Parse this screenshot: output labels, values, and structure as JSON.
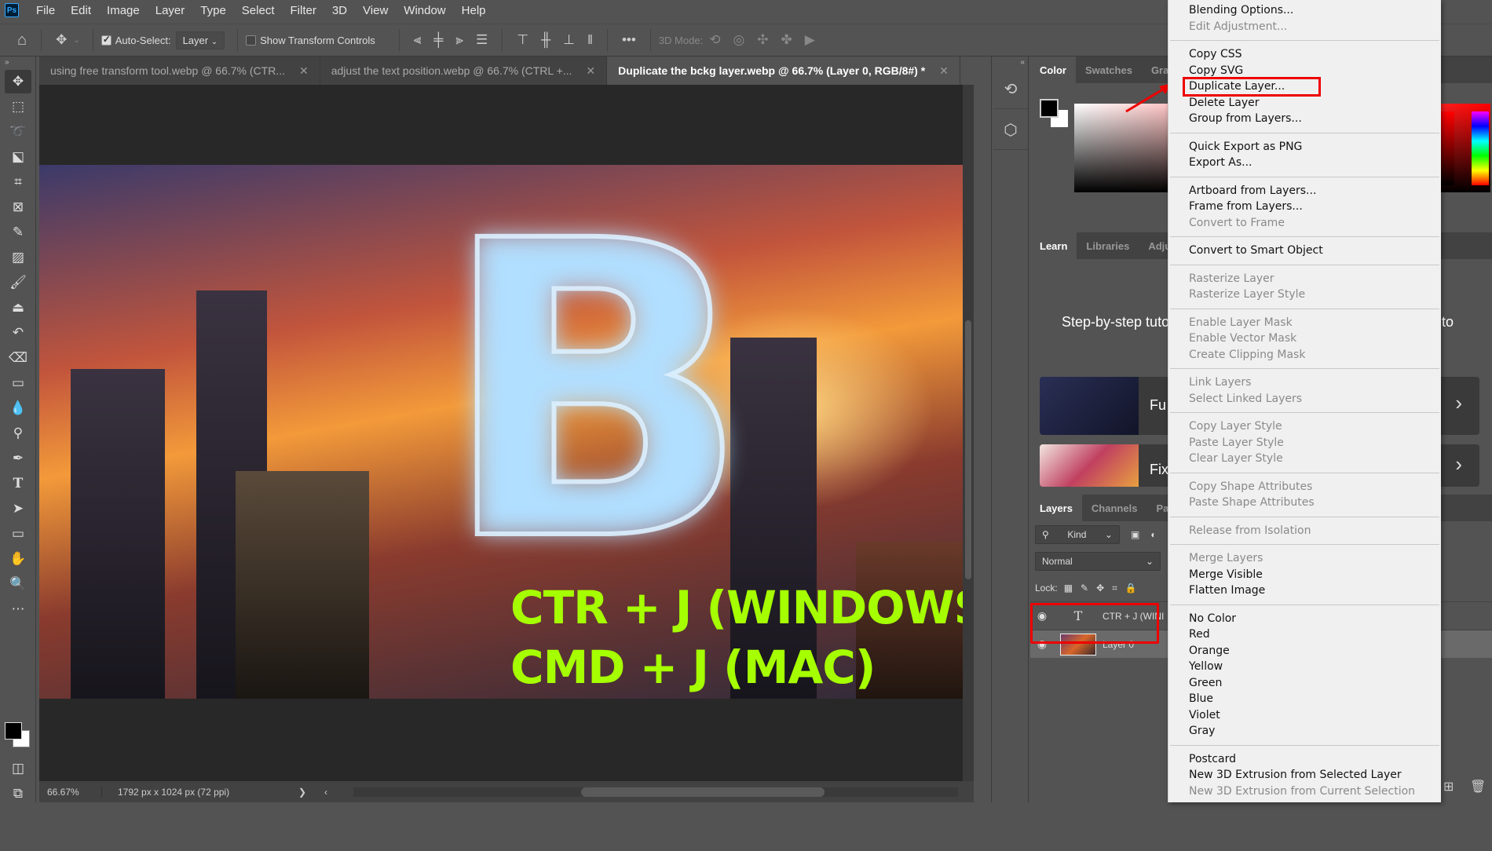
{
  "app": {
    "logo": "Ps"
  },
  "menubar": [
    "File",
    "Edit",
    "Image",
    "Layer",
    "Type",
    "Select",
    "Filter",
    "3D",
    "View",
    "Window",
    "Help"
  ],
  "options_bar": {
    "auto_select_label": "Auto-Select:",
    "auto_select_checked": true,
    "auto_select_target": "Layer",
    "show_transform_label": "Show Transform Controls",
    "show_transform_checked": false,
    "more": "•••",
    "mode_3d_label": "3D Mode:"
  },
  "document_tabs": [
    {
      "label": "using free transform tool.webp @ 66.7% (CTR...",
      "active": false
    },
    {
      "label": "adjust the text position.webp @ 66.7% (CTRL +...",
      "active": false
    },
    {
      "label": "Duplicate the bckg layer.webp @ 66.7% (Layer 0, RGB/8#) *",
      "active": true
    }
  ],
  "canvas": {
    "overlay_line1": "CTR + J (WINDOWS)",
    "overlay_line2": "CMD + J (MAC)",
    "big_letter": "B"
  },
  "status": {
    "zoom": "66.67%",
    "doc_info": "1792 px x 1024 px (72 ppi)",
    "arrow": "❯",
    "scroll_left": "‹"
  },
  "tools": [
    "move",
    "marquee",
    "lasso",
    "object-select",
    "crop",
    "frame",
    "eyedropper",
    "healing-brush",
    "brush",
    "clone-stamp",
    "history-brush",
    "eraser",
    "gradient",
    "blur",
    "dodge",
    "pen",
    "type",
    "path-select",
    "rectangle",
    "hand",
    "zoom",
    "more"
  ],
  "panels": {
    "color_tabs": [
      "Color",
      "Swatches",
      "Gradi"
    ],
    "learn_tabs": [
      "Learn",
      "Libraries",
      "Adjus"
    ],
    "learn_heading": "Step-by-step tuto",
    "learn_heading_right": "to",
    "tutorials": [
      {
        "title": "Fu",
        "chevron": "›"
      },
      {
        "title": "Fix",
        "chevron": "›"
      }
    ],
    "layers_tabs": [
      "Layers",
      "Channels",
      "Paths"
    ],
    "kind_filter": "Kind",
    "blend_mode": "Normal",
    "lock_label": "Lock:",
    "layers": [
      {
        "name": "CTR + J (WINI",
        "type": "text",
        "visible": true,
        "selected": false
      },
      {
        "name": "Layer 0",
        "type": "image",
        "visible": true,
        "selected": true
      }
    ]
  },
  "context_menu": {
    "groups": [
      [
        {
          "label": "Blending Options...",
          "enabled": true
        },
        {
          "label": "Edit Adjustment...",
          "enabled": false
        }
      ],
      [
        {
          "label": "Copy CSS",
          "enabled": true
        },
        {
          "label": "Copy SVG",
          "enabled": true
        },
        {
          "label": "Duplicate Layer...",
          "enabled": true,
          "highlighted": true
        },
        {
          "label": "Delete Layer",
          "enabled": true
        },
        {
          "label": "Group from Layers...",
          "enabled": true
        }
      ],
      [
        {
          "label": "Quick Export as PNG",
          "enabled": true
        },
        {
          "label": "Export As...",
          "enabled": true
        }
      ],
      [
        {
          "label": "Artboard from Layers...",
          "enabled": true
        },
        {
          "label": "Frame from Layers...",
          "enabled": true
        },
        {
          "label": "Convert to Frame",
          "enabled": false
        }
      ],
      [
        {
          "label": "Convert to Smart Object",
          "enabled": true
        }
      ],
      [
        {
          "label": "Rasterize Layer",
          "enabled": false
        },
        {
          "label": "Rasterize Layer Style",
          "enabled": false
        }
      ],
      [
        {
          "label": "Enable Layer Mask",
          "enabled": false
        },
        {
          "label": "Enable Vector Mask",
          "enabled": false
        },
        {
          "label": "Create Clipping Mask",
          "enabled": false
        }
      ],
      [
        {
          "label": "Link Layers",
          "enabled": false
        },
        {
          "label": "Select Linked Layers",
          "enabled": false
        }
      ],
      [
        {
          "label": "Copy Layer Style",
          "enabled": false
        },
        {
          "label": "Paste Layer Style",
          "enabled": false
        },
        {
          "label": "Clear Layer Style",
          "enabled": false
        }
      ],
      [
        {
          "label": "Copy Shape Attributes",
          "enabled": false
        },
        {
          "label": "Paste Shape Attributes",
          "enabled": false
        }
      ],
      [
        {
          "label": "Release from Isolation",
          "enabled": false
        }
      ],
      [
        {
          "label": "Merge Layers",
          "enabled": false
        },
        {
          "label": "Merge Visible",
          "enabled": true
        },
        {
          "label": "Flatten Image",
          "enabled": true
        }
      ],
      [
        {
          "label": "No Color",
          "enabled": true
        },
        {
          "label": "Red",
          "enabled": true
        },
        {
          "label": "Orange",
          "enabled": true
        },
        {
          "label": "Yellow",
          "enabled": true
        },
        {
          "label": "Green",
          "enabled": true
        },
        {
          "label": "Blue",
          "enabled": true
        },
        {
          "label": "Violet",
          "enabled": true
        },
        {
          "label": "Gray",
          "enabled": true
        }
      ],
      [
        {
          "label": "Postcard",
          "enabled": true
        },
        {
          "label": "New 3D Extrusion from Selected Layer",
          "enabled": true
        },
        {
          "label": "New 3D Extrusion from Current Selection",
          "enabled": false
        }
      ]
    ]
  },
  "colors": {
    "highlight": "#e00000",
    "overlay_text": "#a6ff00",
    "accent": "#31a8ff"
  }
}
